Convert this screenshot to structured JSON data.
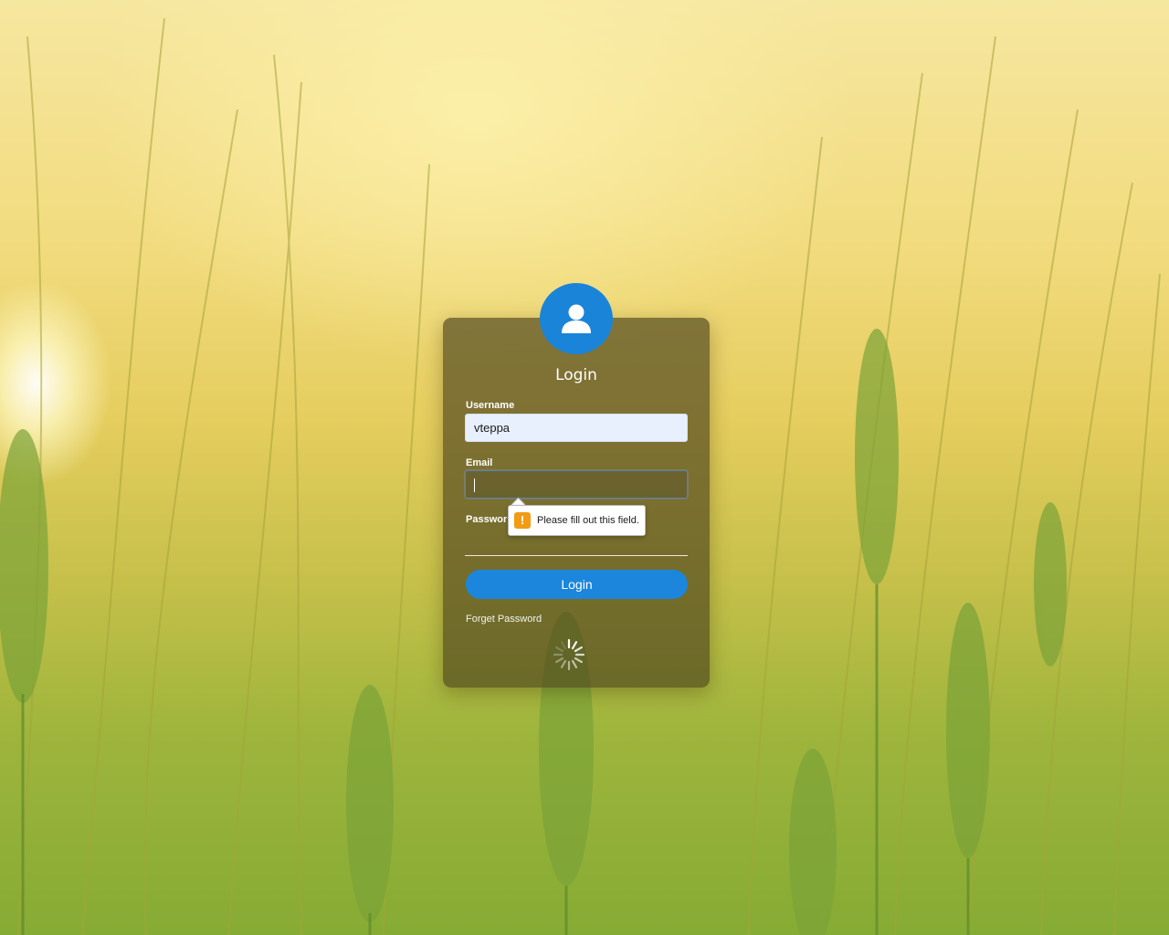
{
  "card": {
    "title": "Login"
  },
  "form": {
    "username_label": "Username",
    "username_value": "vteppa",
    "email_label": "Email",
    "email_value": "",
    "password_label": "Passwor",
    "login_button": "Login",
    "forget_password": "Forget Password"
  },
  "validation": {
    "message": "Please fill out this field.",
    "icon": "warning-icon",
    "icon_glyph": "!"
  },
  "colors": {
    "accent": "#1b86dc",
    "warning": "#f19c14"
  }
}
